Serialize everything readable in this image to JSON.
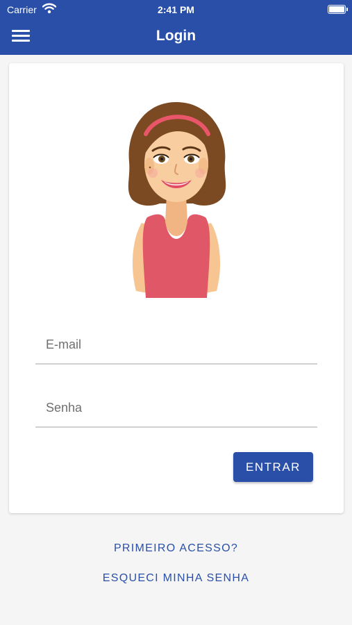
{
  "status_bar": {
    "carrier": "Carrier",
    "time": "2:41 PM"
  },
  "header": {
    "title": "Login"
  },
  "form": {
    "email_placeholder": "E-mail",
    "password_placeholder": "Senha",
    "submit_label": "ENTRAR"
  },
  "links": {
    "first_access": "PRIMEIRO ACESSO?",
    "forgot_password": "ESQUECI MINHA SENHA"
  },
  "icons": [
    "menu-icon",
    "wifi-icon",
    "battery-icon"
  ],
  "colors": {
    "primary": "#2a4fa9",
    "background": "#f5f5f5",
    "card": "#ffffff"
  }
}
